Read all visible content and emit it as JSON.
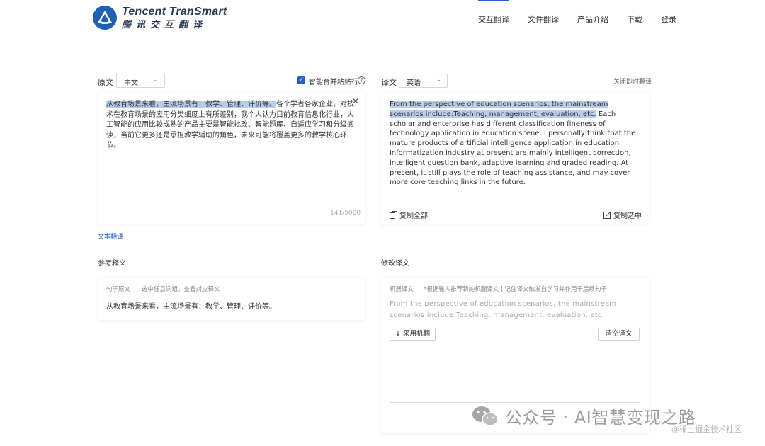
{
  "brand": {
    "name_en": "Tencent TranSmart",
    "name_cn": "腾讯交互翻译"
  },
  "nav": {
    "items": [
      "交互翻译",
      "文件翻译",
      "产品介绍",
      "下载",
      "登录"
    ],
    "active_index": 0
  },
  "source": {
    "label": "原文",
    "language": "中文",
    "merge_lines_label": "智能合并粘贴行",
    "merge_lines_checked": true,
    "text_highlighted": "从教育场景来看，主流场景有：教学、管理、评价等。",
    "text_rest": "各个学者各家企业，对技术在教育场景的应用分类细度上有所差别，我个人认为目前教育信息化行业，人工智能的应用比较成熟的产品主要是智能批改、智能题库、自适应学习和分级阅读，当前它更多还是承担教学辅助的角色，未来可能将覆盖更多的教学核心环节。",
    "char_count": "141/5000"
  },
  "target": {
    "label": "译文",
    "language": "英语",
    "realtime_toggle": "关闭即时翻译",
    "text_highlighted": "From the perspective of education scenarios, the mainstream scenarios include:Teaching, management, evaluation, etc.",
    "text_rest": " Each scholar and enterprise has different classification fineness of technology application in education scene. I personally think that the mature products of artificial intelligence application in education informatization industry at present are mainly intelligent correction, intelligent question bank, adaptive learning and graded reading. At present, it still plays the role of teaching assistance, and may cover more core teaching links in the future.",
    "copy_all": "复制全部",
    "copy_selected": "复制选中"
  },
  "text_translate_link": "文本翻译",
  "reference": {
    "title": "参考释义",
    "sentence_label": "句子原文",
    "hint": "选中任意词组，查看对应释义",
    "sentence": "从教育场景来看，主流场景有：教学、管理、评价等。"
  },
  "revise": {
    "title": "修改译文",
    "mt_label": "机器译文",
    "hint": "*根据输入推荐新的机翻译文 | 记住译文触发自学习并作用于后续句子",
    "mt_text": "From the perspective of education scenarios, the mainstream scenarios include:Teaching, management, evaluation, etc.",
    "adopt_button": "↓ 采用机翻",
    "clear_button": "清空译文",
    "edit_value": ""
  },
  "watermark": {
    "text": "公众号 · AI智慧变现之路",
    "sub": "@稀土掘金技术社区"
  },
  "colors": {
    "accent": "#1f63c9",
    "highlight": "#b7cdea",
    "logo": "#1f5fb4"
  }
}
